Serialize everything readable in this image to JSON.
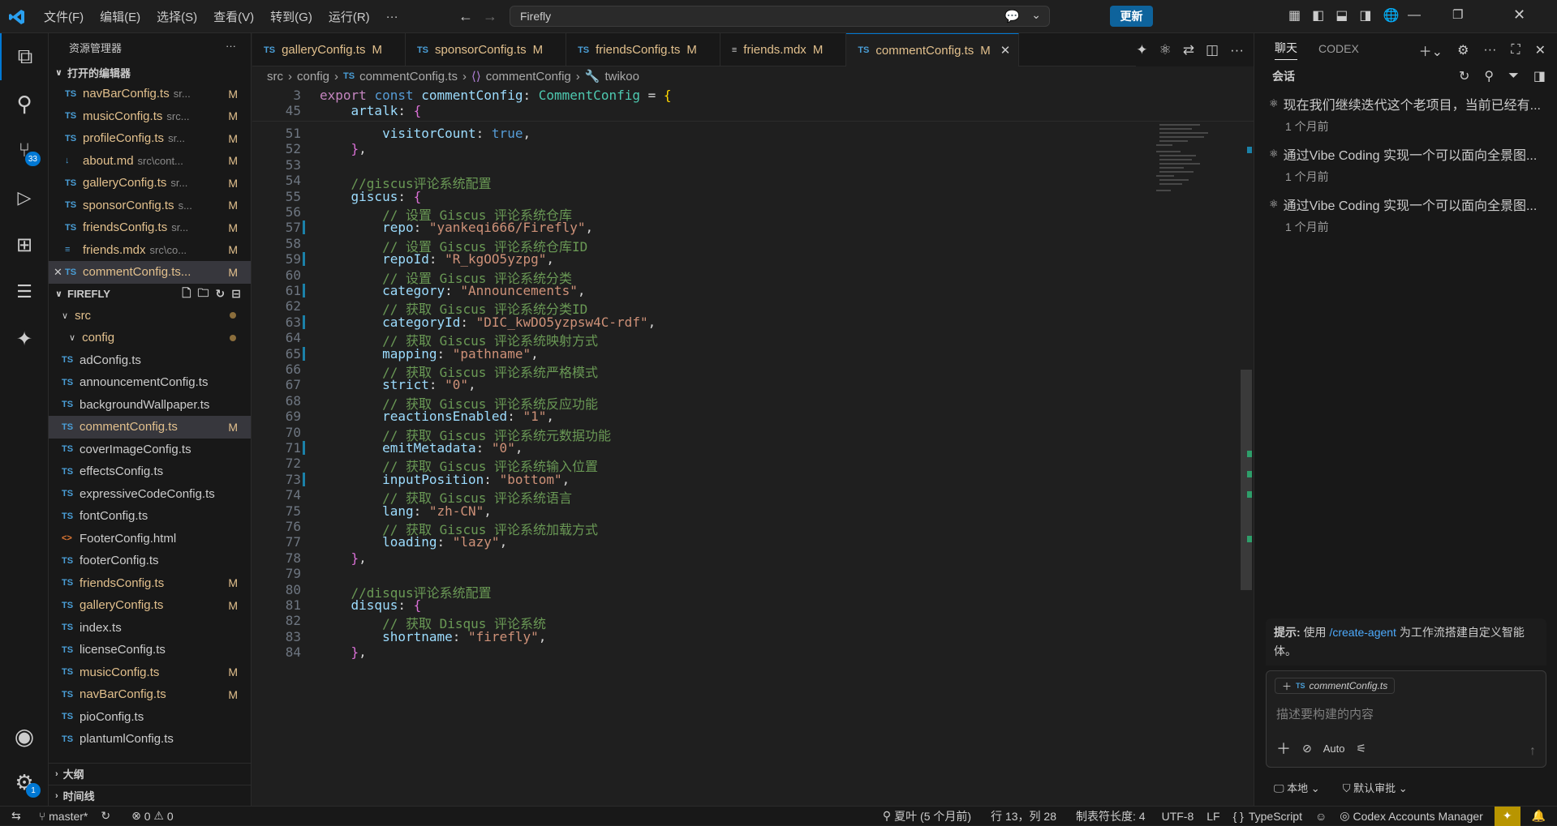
{
  "titlebar": {
    "menus": [
      "文件(F)",
      "编辑(E)",
      "选择(S)",
      "查看(V)",
      "转到(G)",
      "运行(R)",
      "···"
    ],
    "search": "Firefly",
    "update_label": "更新"
  },
  "activity": {
    "scm_badge": "33",
    "account_badge": "1"
  },
  "sidebar": {
    "title": "资源管理器",
    "open_editors_label": "打开的编辑器",
    "open_editors": [
      {
        "icon": "TS",
        "name": "navBarConfig.ts",
        "path": "sr...",
        "status": "M"
      },
      {
        "icon": "TS",
        "name": "musicConfig.ts",
        "path": "src...",
        "status": "M"
      },
      {
        "icon": "TS",
        "name": "profileConfig.ts",
        "path": "sr...",
        "status": "M"
      },
      {
        "icon": "↓",
        "name": "about.md",
        "path": "src\\cont...",
        "status": "M"
      },
      {
        "icon": "TS",
        "name": "galleryConfig.ts",
        "path": "sr...",
        "status": "M"
      },
      {
        "icon": "TS",
        "name": "sponsorConfig.ts",
        "path": "s...",
        "status": "M"
      },
      {
        "icon": "TS",
        "name": "friendsConfig.ts",
        "path": "sr...",
        "status": "M"
      },
      {
        "icon": "≡",
        "name": "friends.mdx",
        "path": "src\\co...",
        "status": "M"
      },
      {
        "icon": "TS",
        "name": "commentConfig.ts...",
        "path": "",
        "status": "M"
      }
    ],
    "project_label": "FIREFLY",
    "src_label": "src",
    "config_label": "config",
    "files": [
      {
        "icon": "TS",
        "name": "adConfig.ts",
        "status": ""
      },
      {
        "icon": "TS",
        "name": "announcementConfig.ts",
        "status": ""
      },
      {
        "icon": "TS",
        "name": "backgroundWallpaper.ts",
        "status": ""
      },
      {
        "icon": "TS",
        "name": "commentConfig.ts",
        "status": "M"
      },
      {
        "icon": "TS",
        "name": "coverImageConfig.ts",
        "status": ""
      },
      {
        "icon": "TS",
        "name": "effectsConfig.ts",
        "status": ""
      },
      {
        "icon": "TS",
        "name": "expressiveCodeConfig.ts",
        "status": ""
      },
      {
        "icon": "TS",
        "name": "fontConfig.ts",
        "status": ""
      },
      {
        "icon": "<>",
        "name": "FooterConfig.html",
        "status": ""
      },
      {
        "icon": "TS",
        "name": "footerConfig.ts",
        "status": ""
      },
      {
        "icon": "TS",
        "name": "friendsConfig.ts",
        "status": "M"
      },
      {
        "icon": "TS",
        "name": "galleryConfig.ts",
        "status": "M"
      },
      {
        "icon": "TS",
        "name": "index.ts",
        "status": ""
      },
      {
        "icon": "TS",
        "name": "licenseConfig.ts",
        "status": ""
      },
      {
        "icon": "TS",
        "name": "musicConfig.ts",
        "status": "M"
      },
      {
        "icon": "TS",
        "name": "navBarConfig.ts",
        "status": "M"
      },
      {
        "icon": "TS",
        "name": "pioConfig.ts",
        "status": ""
      },
      {
        "icon": "TS",
        "name": "plantumlConfig.ts",
        "status": ""
      }
    ],
    "outline_label": "大纲",
    "timeline_label": "时间线"
  },
  "tabs": [
    {
      "icon": "TS",
      "name": "galleryConfig.ts",
      "status": "M"
    },
    {
      "icon": "TS",
      "name": "sponsorConfig.ts",
      "status": "M"
    },
    {
      "icon": "TS",
      "name": "friendsConfig.ts",
      "status": "M"
    },
    {
      "icon": "≡",
      "name": "friends.mdx",
      "status": "M"
    },
    {
      "icon": "TS",
      "name": "commentConfig.ts",
      "status": "M"
    }
  ],
  "breadcrumb": [
    "src",
    "config",
    "commentConfig.ts",
    "commentConfig",
    "twikoo"
  ],
  "sticky": [
    {
      "n": "3",
      "html": "<span class=\"kw\">export</span> <span class=\"kb\">const</span> <span class=\"vr\">commentConfig</span><span class=\"pr\">: </span><span class=\"ty\">CommentConfig</span><span class=\"pr\"> = </span><span class=\"br1\">{</span>"
    },
    {
      "n": "45",
      "html": "    <span class=\"vr\">artalk</span><span class=\"pr\">: </span><span class=\"br2\">{</span>"
    }
  ],
  "code": [
    {
      "n": "51",
      "html": "        <span class=\"vr\">visitorCount</span><span class=\"pr\">: </span><span class=\"kb\">true</span><span class=\"pr\">,</span>"
    },
    {
      "n": "52",
      "html": "    <span class=\"br2\">}</span><span class=\"pr\">,</span>"
    },
    {
      "n": "53",
      "html": ""
    },
    {
      "n": "54",
      "html": "    <span class=\"cm\">//giscus评论系统配置</span>"
    },
    {
      "n": "55",
      "html": "    <span class=\"vr\">giscus</span><span class=\"pr\">: </span><span class=\"br2\">{</span>"
    },
    {
      "n": "56",
      "html": "        <span class=\"cm\">// 设置 Giscus 评论系统仓库</span>"
    },
    {
      "n": "57",
      "html": "        <span class=\"vr\">repo</span><span class=\"pr\">: </span><span class=\"st\">\"yankeqi666/Firefly\"</span><span class=\"pr\">,</span>"
    },
    {
      "n": "58",
      "html": "        <span class=\"cm\">// 设置 Giscus 评论系统仓库ID</span>"
    },
    {
      "n": "59",
      "html": "        <span class=\"vr\">repoId</span><span class=\"pr\">: </span><span class=\"st\">\"R_kgOO5yzpg\"</span><span class=\"pr\">,</span>"
    },
    {
      "n": "60",
      "html": "        <span class=\"cm\">// 设置 Giscus 评论系统分类</span>"
    },
    {
      "n": "61",
      "html": "        <span class=\"vr\">category</span><span class=\"pr\">: </span><span class=\"st\">\"Announcements\"</span><span class=\"pr\">,</span>"
    },
    {
      "n": "62",
      "html": "        <span class=\"cm\">// 获取 Giscus 评论系统分类ID</span>"
    },
    {
      "n": "63",
      "html": "        <span class=\"vr\">categoryId</span><span class=\"pr\">: </span><span class=\"st\">\"DIC_kwDO5yzpsw4C-rdf\"</span><span class=\"pr\">,</span>"
    },
    {
      "n": "64",
      "html": "        <span class=\"cm\">// 获取 Giscus 评论系统映射方式</span>"
    },
    {
      "n": "65",
      "html": "        <span class=\"vr\">mapping</span><span class=\"pr\">: </span><span class=\"st\">\"pathname\"</span><span class=\"pr\">,</span>"
    },
    {
      "n": "66",
      "html": "        <span class=\"cm\">// 获取 Giscus 评论系统严格模式</span>"
    },
    {
      "n": "67",
      "html": "        <span class=\"vr\">strict</span><span class=\"pr\">: </span><span class=\"st\">\"0\"</span><span class=\"pr\">,</span>"
    },
    {
      "n": "68",
      "html": "        <span class=\"cm\">// 获取 Giscus 评论系统反应功能</span>"
    },
    {
      "n": "69",
      "html": "        <span class=\"vr\">reactionsEnabled</span><span class=\"pr\">: </span><span class=\"st\">\"1\"</span><span class=\"pr\">,</span>"
    },
    {
      "n": "70",
      "html": "        <span class=\"cm\">// 获取 Giscus 评论系统元数据功能</span>"
    },
    {
      "n": "71",
      "html": "        <span class=\"vr\">emitMetadata</span><span class=\"pr\">: </span><span class=\"st\">\"0\"</span><span class=\"pr\">,</span>"
    },
    {
      "n": "72",
      "html": "        <span class=\"cm\">// 获取 Giscus 评论系统输入位置</span>"
    },
    {
      "n": "73",
      "html": "        <span class=\"vr\">inputPosition</span><span class=\"pr\">: </span><span class=\"st\">\"bottom\"</span><span class=\"pr\">,</span>"
    },
    {
      "n": "74",
      "html": "        <span class=\"cm\">// 获取 Giscus 评论系统语言</span>"
    },
    {
      "n": "75",
      "html": "        <span class=\"vr\">lang</span><span class=\"pr\">: </span><span class=\"st\">\"zh-CN\"</span><span class=\"pr\">,</span>"
    },
    {
      "n": "76",
      "html": "        <span class=\"cm\">// 获取 Giscus 评论系统加载方式</span>"
    },
    {
      "n": "77",
      "html": "        <span class=\"vr\">loading</span><span class=\"pr\">: </span><span class=\"st\">\"lazy\"</span><span class=\"pr\">,</span>"
    },
    {
      "n": "78",
      "html": "    <span class=\"br2\">}</span><span class=\"pr\">,</span>"
    },
    {
      "n": "79",
      "html": ""
    },
    {
      "n": "80",
      "html": "    <span class=\"cm\">//disqus评论系统配置</span>"
    },
    {
      "n": "81",
      "html": "    <span class=\"vr\">disqus</span><span class=\"pr\">: </span><span class=\"br2\">{</span>"
    },
    {
      "n": "82",
      "html": "        <span class=\"cm\">// 获取 Disqus 评论系统</span>"
    },
    {
      "n": "83",
      "html": "        <span class=\"vr\">shortname</span><span class=\"pr\">: </span><span class=\"st\">\"firefly\"</span><span class=\"pr\">,</span>"
    },
    {
      "n": "84",
      "html": "    <span class=\"br2\">}</span><span class=\"pr\">,</span>"
    }
  ],
  "chat": {
    "tab_chat": "聊天",
    "tab_codex": "CODEX",
    "section": "会话",
    "items": [
      {
        "title": "现在我们继续迭代这个老项目，当前已经有...",
        "time": "1 个月前"
      },
      {
        "title": "通过Vibe Coding 实现一个可以面向全景图...",
        "time": "1 个月前"
      },
      {
        "title": "通过Vibe Coding 实现一个可以面向全景图...",
        "time": "1 个月前"
      }
    ],
    "tip_label": "提示:",
    "tip_pre": " 使用 ",
    "tip_link": "/create-agent",
    "tip_post": " 为工作流搭建自定义智能体。",
    "context_file": "commentConfig.ts",
    "input_placeholder": "描述要构建的内容",
    "mode": "Auto",
    "local_label": "本地",
    "approval_label": "默认审批"
  },
  "status": {
    "branch": "master*",
    "errors": "0",
    "warnings": "0",
    "blame": "夏叶 (5 个月前)",
    "position": "行 13，列 28",
    "tab_size": "制表符长度: 4",
    "encoding": "UTF-8",
    "eol": "LF",
    "language": "TypeScript",
    "accounts": "Codex Accounts Manager"
  }
}
